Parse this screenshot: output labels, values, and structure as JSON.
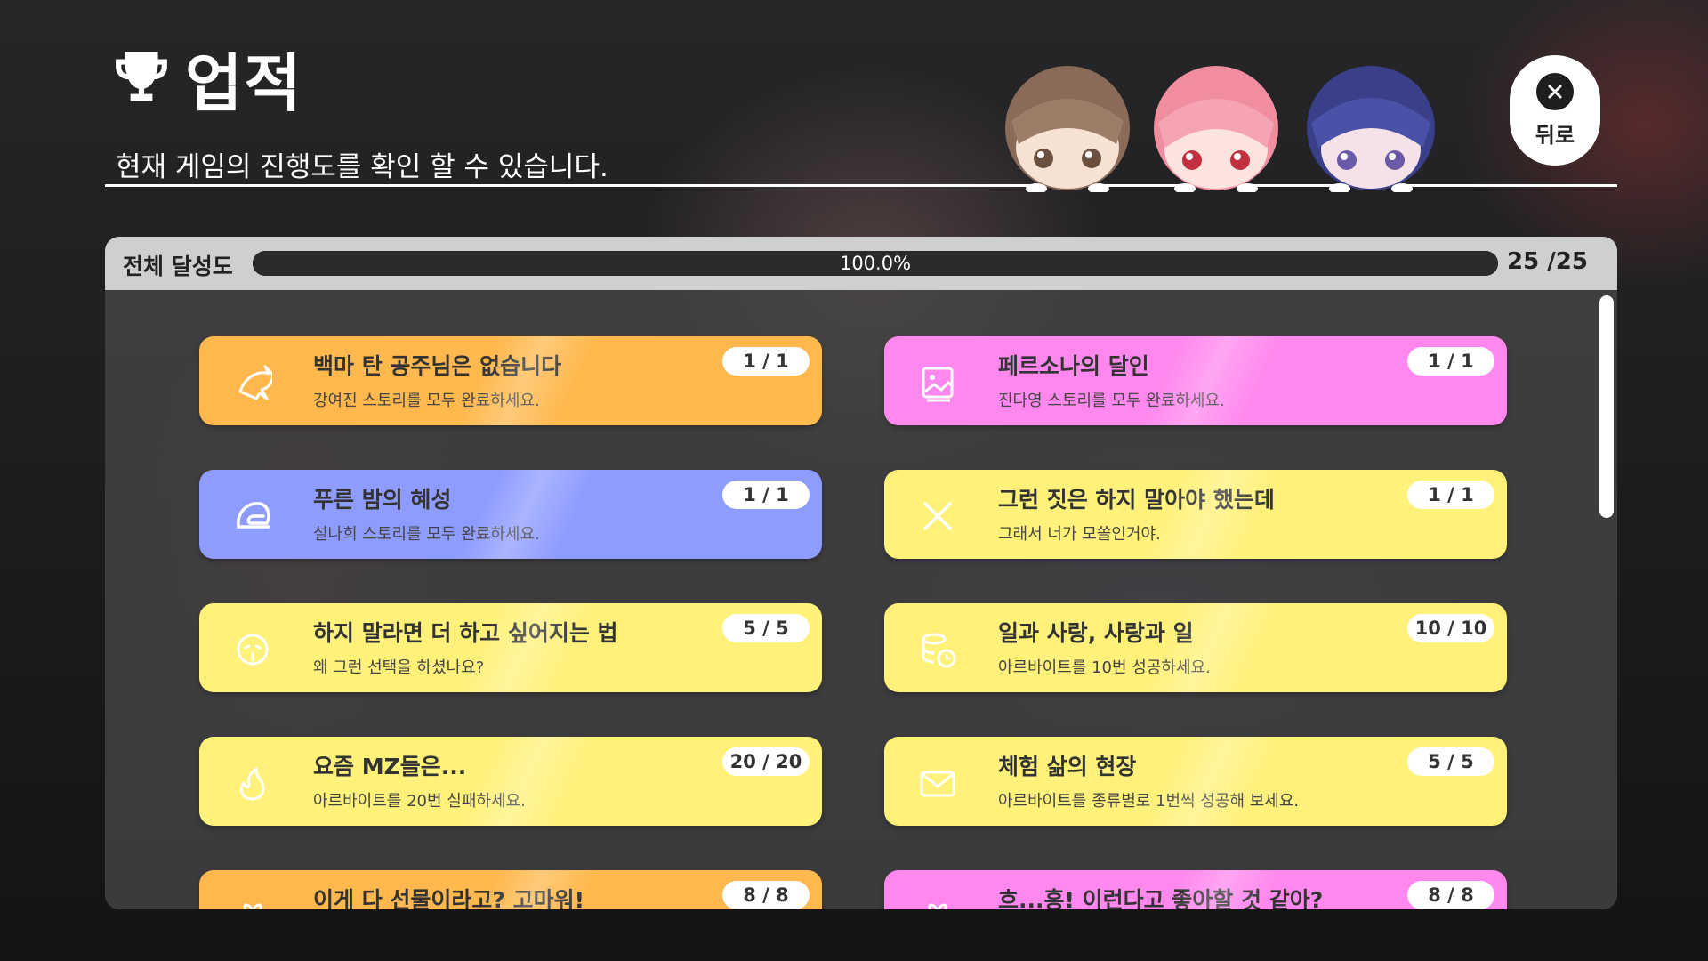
{
  "header": {
    "title": "업적",
    "subtitle": "현재 게임의 진행도를 확인 할 수 있습니다.",
    "back_label": "뒤로"
  },
  "progress": {
    "label": "전체 달성도",
    "percent_text": "100.0%",
    "fraction": 1.0,
    "count": "25 /25"
  },
  "achievements": [
    {
      "title": "백마 탄 공주님은 없습니다",
      "desc": "강여진 스토리를 모두 완료하세요.",
      "count": "1 / 1",
      "color": "#ffb84d",
      "icon": "dolphin-icon"
    },
    {
      "title": "페르소나의 달인",
      "desc": "진다영 스토리를 모두 완료하세요.",
      "count": "1 / 1",
      "color": "#ff88ee",
      "icon": "image-icon"
    },
    {
      "title": "푸른 밤의 혜성",
      "desc": "설나희 스토리를 모두 완료하세요.",
      "count": "1 / 1",
      "color": "#8e9bff",
      "icon": "helmet-icon"
    },
    {
      "title": "그런 짓은 하지 말아야 했는데",
      "desc": "그래서 너가 모쏠인거야.",
      "count": "1 / 1",
      "color": "#fff17a",
      "icon": "x-icon"
    },
    {
      "title": "하지 말라면 더 하고 싶어지는 법",
      "desc": "왜 그런 선택을 하셨나요?",
      "count": "5 / 5",
      "color": "#fff17a",
      "icon": "sad-face-icon"
    },
    {
      "title": "일과 사랑, 사랑과 일",
      "desc": "아르바이트를 10번 성공하세요.",
      "count": "10 / 10",
      "color": "#fff17a",
      "icon": "coins-clock-icon"
    },
    {
      "title": "요즘 MZ들은...",
      "desc": "아르바이트를 20번 실패하세요.",
      "count": "20 / 20",
      "color": "#fff17a",
      "icon": "flame-icon"
    },
    {
      "title": "체험 삶의 현장",
      "desc": "아르바이트를 종류별로 1번씩 성공해 보세요.",
      "count": "5 / 5",
      "color": "#fff17a",
      "icon": "mail-icon"
    },
    {
      "title": "이게 다 선물이라고? 고마워!",
      "desc": "",
      "count": "8 / 8",
      "color": "#ffb84d",
      "icon": "gift-icon"
    },
    {
      "title": "흐...흥! 이런다고 좋아할 것 같아?",
      "desc": "",
      "count": "8 / 8",
      "color": "#ff88ee",
      "icon": "gift-icon"
    }
  ]
}
